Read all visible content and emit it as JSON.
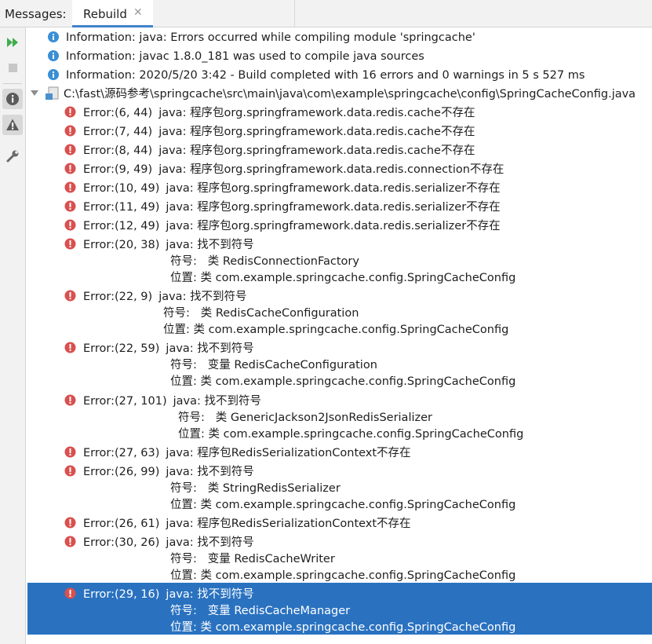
{
  "header": {
    "title": "Messages:",
    "tab_label": "Rebuild",
    "tab_close": "✕"
  },
  "toolbar": {
    "buttons": [
      {
        "name": "rerun-icon",
        "active": false
      },
      {
        "name": "stop-icon",
        "active": false
      },
      {
        "name": "info-filter-icon",
        "active": true
      },
      {
        "name": "warning-filter-icon",
        "active": true
      },
      {
        "name": "wrench-icon",
        "active": false
      }
    ]
  },
  "messages": {
    "info": [
      "Information: java: Errors occurred while compiling module 'springcache'",
      "Information: javac 1.8.0_181 was used to compile java sources",
      "Information: 2020/5/20 3:42 - Build completed with 16 errors and 0 warnings in 5 s 527 ms"
    ],
    "file_path": "C:\\fast\\源码参考\\springcache\\src\\main\\java\\com\\example\\springcache\\config\\SpringCacheConfig.java",
    "errors": [
      {
        "loc": "Error:(6, 44)",
        "msg": "java: 程序包org.springframework.data.redis.cache不存在"
      },
      {
        "loc": "Error:(7, 44)",
        "msg": "java: 程序包org.springframework.data.redis.cache不存在"
      },
      {
        "loc": "Error:(8, 44)",
        "msg": "java: 程序包org.springframework.data.redis.cache不存在"
      },
      {
        "loc": "Error:(9, 49)",
        "msg": "java: 程序包org.springframework.data.redis.connection不存在"
      },
      {
        "loc": "Error:(10, 49)",
        "msg": "java: 程序包org.springframework.data.redis.serializer不存在"
      },
      {
        "loc": "Error:(11, 49)",
        "msg": "java: 程序包org.springframework.data.redis.serializer不存在"
      },
      {
        "loc": "Error:(12, 49)",
        "msg": "java: 程序包org.springframework.data.redis.serializer不存在"
      },
      {
        "loc": "Error:(20, 38)",
        "msg": "java: 找不到符号",
        "l2": "符号:   类 RedisConnectionFactory",
        "l3": "位置: 类 com.example.springcache.config.SpringCacheConfig"
      },
      {
        "loc": "Error:(22, 9)",
        "msg": "java: 找不到符号",
        "l2": "符号:   类 RedisCacheConfiguration",
        "l3": "位置: 类 com.example.springcache.config.SpringCacheConfig"
      },
      {
        "loc": "Error:(22, 59)",
        "msg": "java: 找不到符号",
        "l2": "符号:   变量 RedisCacheConfiguration",
        "l3": "位置: 类 com.example.springcache.config.SpringCacheConfig"
      },
      {
        "loc": "Error:(27, 101)",
        "msg": "java: 找不到符号",
        "l2": "符号:   类 GenericJackson2JsonRedisSerializer",
        "l3": "位置: 类 com.example.springcache.config.SpringCacheConfig"
      },
      {
        "loc": "Error:(27, 63)",
        "msg": "java: 程序包RedisSerializationContext不存在"
      },
      {
        "loc": "Error:(26, 99)",
        "msg": "java: 找不到符号",
        "l2": "符号:   类 StringRedisSerializer",
        "l3": "位置: 类 com.example.springcache.config.SpringCacheConfig"
      },
      {
        "loc": "Error:(26, 61)",
        "msg": "java: 程序包RedisSerializationContext不存在"
      },
      {
        "loc": "Error:(30, 26)",
        "msg": "java: 找不到符号",
        "l2": "符号:   变量 RedisCacheWriter",
        "l3": "位置: 类 com.example.springcache.config.SpringCacheConfig"
      },
      {
        "loc": "Error:(29, 16)",
        "msg": "java: 找不到符号",
        "l2": "符号:   变量 RedisCacheManager",
        "l3": "位置: 类 com.example.springcache.config.SpringCacheConfig",
        "selected": true
      }
    ]
  },
  "colors": {
    "info_icon": "#3a8fd6",
    "error_icon": "#d9504f",
    "selection": "#2a72c0",
    "tab_underline": "#4083c9"
  }
}
